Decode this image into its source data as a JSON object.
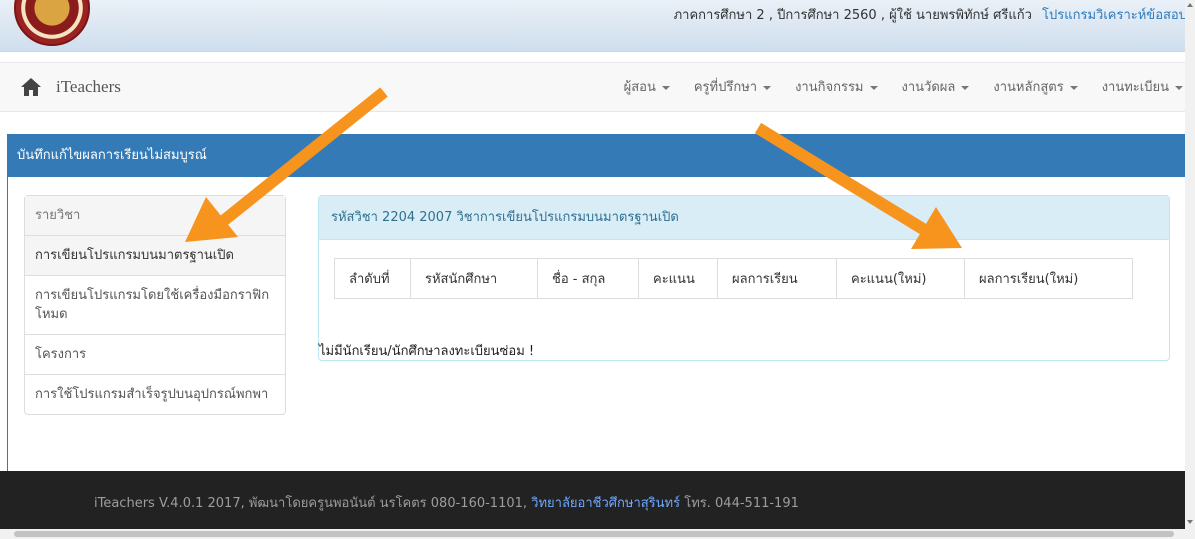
{
  "banner": {
    "info_text": "ภาคการศึกษา 2 , ปีการศึกษา 2560 , ผู้ใช้ นายพรพิทักษ์ ศรีแก้ว",
    "link_text": "โปรแกรมวิเคราะห์ข้อสอบ"
  },
  "navbar": {
    "brand": "iTeachers",
    "items": [
      "ผู้สอน",
      "ครูที่ปรึกษา",
      "งานกิจกรรม",
      "งานวัดผล",
      "งานหลักสูตร",
      "งานทะเบียน"
    ]
  },
  "panel": {
    "title": "บันทึกแก้ไขผลการเรียนไม่สมบูรณ์"
  },
  "subjects": {
    "header": "รายวิชา",
    "items": [
      "การเขียนโปรแกรมบนมาตรฐานเปิด",
      "การเขียนโปรแกรมโดยใช้เครื่องมือกราฟิกโหมด",
      "โครงการ",
      "การใช้โปรแกรมสำเร็จรูปบนอุปกรณ์พกพา"
    ]
  },
  "detail": {
    "heading": "รหัสวิชา 2204 2007 วิชาการเขียนโปรแกรมบนมาตรฐานเปิด",
    "columns": [
      "ลำดับที่",
      "รหัสนักศึกษา",
      "ชื่อ - สกุล",
      "คะแนน",
      "ผลการเรียน",
      "คะแนน(ใหม่)",
      "ผลการเรียน(ใหม่)"
    ],
    "empty_message": "ไม่มีนักเรียน/นักศึกษาลงทะเบียนซ่อม !"
  },
  "footer": {
    "text": "iTeachers V.4.0.1 2017, พัฒนาโดยครูนพอนันต์ นรโคตร 080-160-1101,",
    "link": "วิทยาลัยอาชีวศึกษาสุรินทร์",
    "phone": " โทร. 044-511-191"
  },
  "colors": {
    "primary": "#337ab7",
    "info_bg": "#d9edf7",
    "annotation_arrow": "#f7941d",
    "footer_bg": "#222222"
  }
}
